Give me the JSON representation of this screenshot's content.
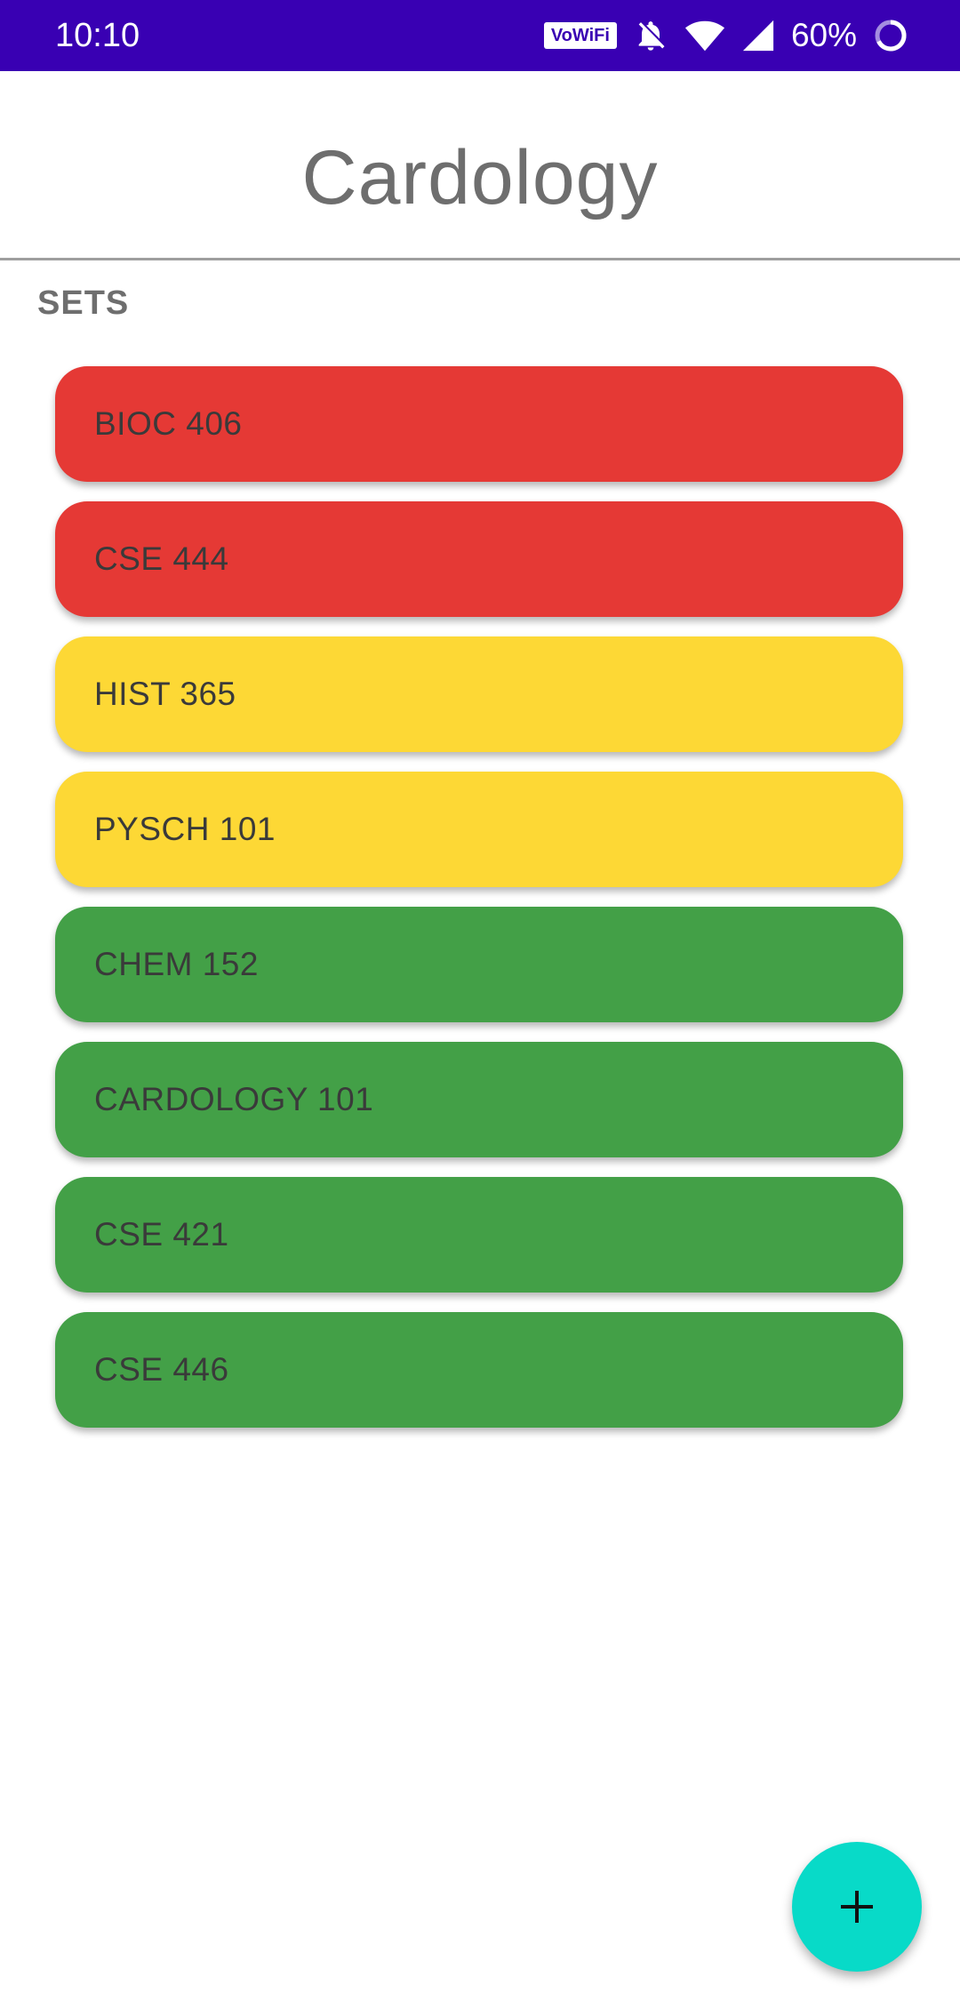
{
  "status_bar": {
    "time": "10:10",
    "vowifi_label": "VoWiFi",
    "battery": "60%",
    "icons": [
      "vowifi-icon",
      "bell-off-icon",
      "wifi-icon",
      "cell-signal-icon",
      "battery-ring-icon"
    ],
    "background_color": "#3900b3"
  },
  "header": {
    "title": "Cardology"
  },
  "section": {
    "label": "SETS"
  },
  "sets": [
    {
      "label": "BIOC 406",
      "color": "#e53935"
    },
    {
      "label": "CSE 444",
      "color": "#e53935"
    },
    {
      "label": "HIST 365",
      "color": "#fdd835"
    },
    {
      "label": "PYSCH 101",
      "color": "#fdd835"
    },
    {
      "label": "CHEM 152",
      "color": "#43a047"
    },
    {
      "label": "CARDOLOGY 101",
      "color": "#43a047"
    },
    {
      "label": "CSE 421",
      "color": "#43a047"
    },
    {
      "label": "CSE 446",
      "color": "#43a047"
    }
  ],
  "fab": {
    "icon": "plus-icon",
    "color": "#08dac8"
  }
}
